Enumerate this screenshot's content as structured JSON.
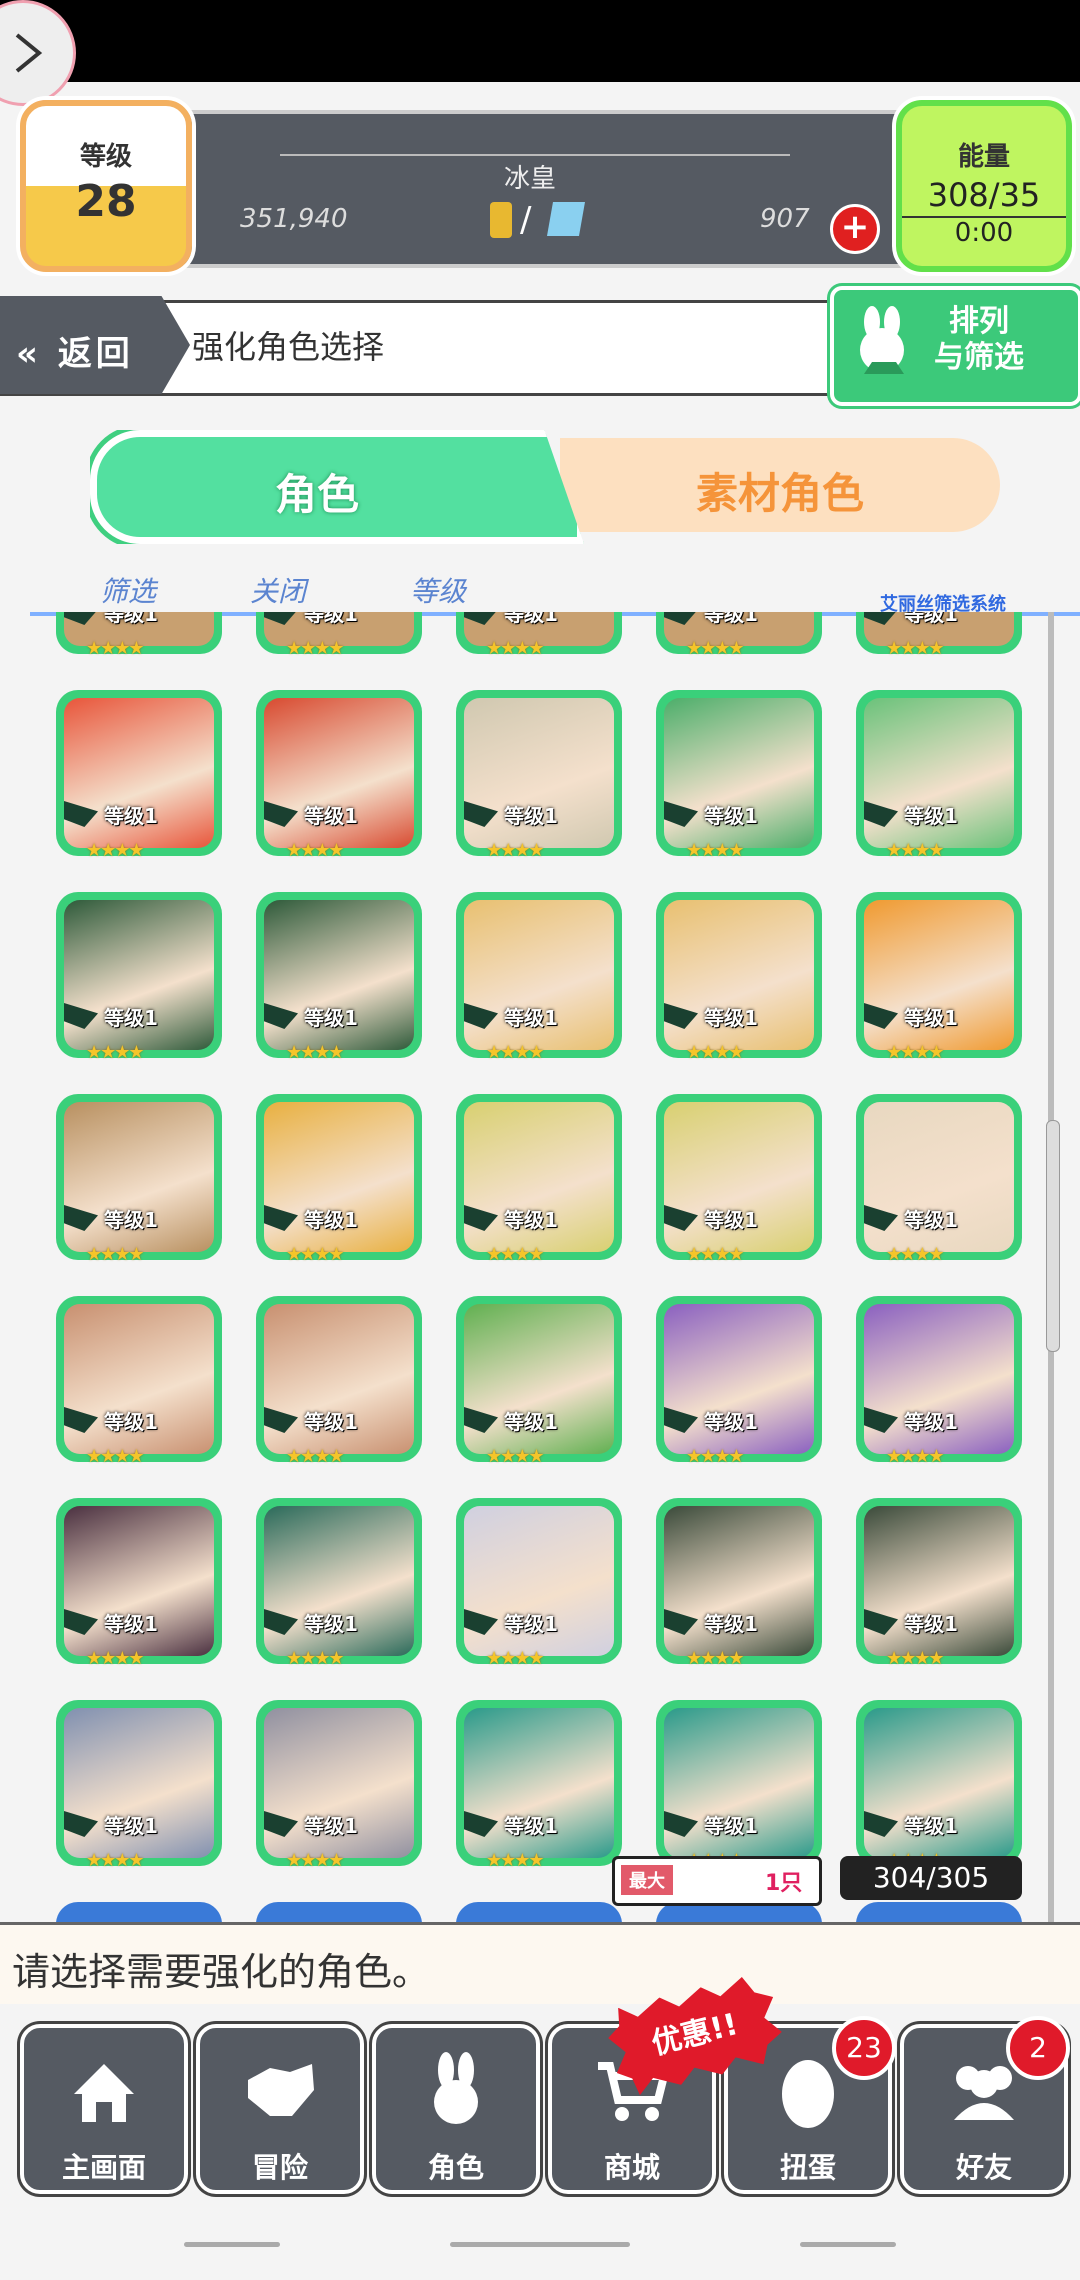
{
  "header": {
    "level_label": "等级",
    "level_value": "28",
    "player_name": "冰皇",
    "coins": "351,940",
    "gems": "907",
    "energy_label": "能量",
    "energy_value": "308/35",
    "energy_timer": "0:00"
  },
  "nav": {
    "return_label": "返回",
    "page_title": "强化角色选择",
    "sort_filter_label_1": "排列",
    "sort_filter_label_2": "与筛选"
  },
  "tabs": {
    "character": "角色",
    "material": "素材角色"
  },
  "filter_strip": {
    "filter": "筛选",
    "close": "关闭",
    "level": "等级",
    "system": "艾丽丝筛选系统"
  },
  "grid": {
    "card_level_text": "等级1",
    "card_stars": "★★★★",
    "portrait_colors": [
      [
        "#e8553a",
        "#d84a30",
        "#d0c8b0",
        "#4cae6a",
        "#6ac27a"
      ],
      [
        "#2e5a3a",
        "#2e5a3a",
        "#e8c070",
        "#e8c070",
        "#f09a30"
      ],
      [
        "#b89060",
        "#e8b040",
        "#d8d070",
        "#d8d070",
        "#e8d8c0"
      ],
      [
        "#c89070",
        "#c89070",
        "#60b050",
        "#8a60c0",
        "#8a60c0"
      ],
      [
        "#4a3040",
        "#2a6a5a",
        "#d0d0e0",
        "#3a4a3a",
        "#3a4a3a"
      ],
      [
        "#8090b0",
        "#9090a0",
        "#2a9a8a",
        "#2a9a8a",
        "#2a9a8a"
      ]
    ]
  },
  "counters": {
    "max_label": "最大",
    "max_value": "1只",
    "count": "304/305"
  },
  "message": "请选择需要强化的角色。",
  "bottom_nav": [
    {
      "label": "主画面",
      "icon": "home-icon"
    },
    {
      "label": "冒险",
      "icon": "handshake-icon"
    },
    {
      "label": "角色",
      "icon": "rabbit-icon"
    },
    {
      "label": "商城",
      "icon": "cart-icon"
    },
    {
      "label": "扭蛋",
      "icon": "egg-icon"
    },
    {
      "label": "好友",
      "icon": "friends-icon"
    }
  ],
  "badges": {
    "promo": "优惠!!",
    "gacha_count": "23",
    "friends_count": "2"
  },
  "colors": {
    "accent_green": "#3ad07a",
    "accent_orange": "#f5943a",
    "panel_gray": "#555a62",
    "badge_red": "#e01a2a"
  }
}
